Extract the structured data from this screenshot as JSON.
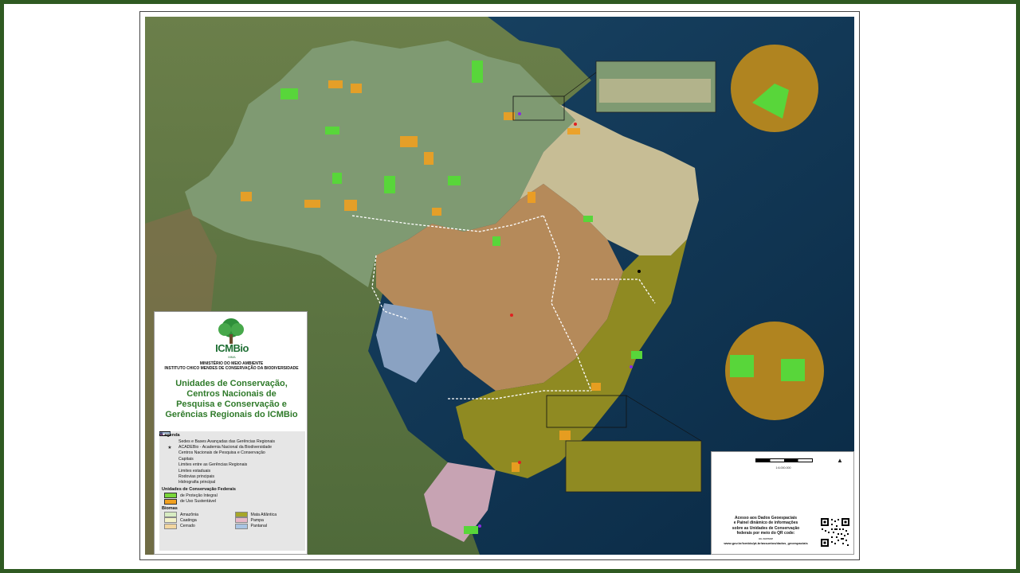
{
  "logo": {
    "name": "ICMBio",
    "subtitle": "MMA"
  },
  "ministry": {
    "line1": "MINISTÉRIO DO MEIO AMBIENTE",
    "line2": "INSTITUTO CHICO MENDES DE CONSERVAÇÃO DA BIODIVERSIDADE"
  },
  "title": {
    "line1": "Unidades de Conservação,",
    "line2": "Centros Nacionais de",
    "line3": "Pesquisa e Conservação e",
    "line4": "Gerências Regionais do ICMBio"
  },
  "legend": {
    "heading": "Legenda",
    "items": [
      {
        "label": "Sedes e Bases Avançadas das Gerências Regionais",
        "symbol": "red-dot"
      },
      {
        "label": "ACADEBio - Academia Nacional da Biodiversidade",
        "symbol": "star"
      },
      {
        "label": "Centros Nacionais de Pesquisa e Conservação",
        "symbol": "purple-dot"
      },
      {
        "label": "Capitais",
        "symbol": "black-dot"
      },
      {
        "label": "Limites entre as Gerências Regionais",
        "symbol": "white-line"
      },
      {
        "label": "Limites estaduais",
        "symbol": "black-box"
      },
      {
        "label": "Rodovias principais",
        "symbol": "red-line"
      },
      {
        "label": "Hidrografia principal",
        "symbol": "blue-line"
      }
    ],
    "uc_heading": "Unidades de Conservação Federais",
    "uc_items": [
      {
        "label": "de Proteção Integral",
        "color": "#7ad63a"
      },
      {
        "label": "de Uso Sustentável",
        "color": "#f0a020"
      }
    ],
    "biomas_heading": "Biomas",
    "biomas": [
      {
        "label": "Amazônia",
        "color": "#d7ecc2"
      },
      {
        "label": "Mata Atlântica",
        "color": "#a6a629"
      },
      {
        "label": "Caatinga",
        "color": "#f3f2c8"
      },
      {
        "label": "Pampa",
        "color": "#e8b7c8"
      },
      {
        "label": "Cerrado",
        "color": "#f2d6a0"
      },
      {
        "label": "Pantanal",
        "color": "#a9c4e3"
      }
    ]
  },
  "info": {
    "scale": "1:6.000.000",
    "access_line1": "Acesso aos Dados Geoespaciais",
    "access_line2": "e Painel dinâmico de informações",
    "access_line3": "sobre as Unidades de Conservação",
    "access_line4": "federais por meio do QR code:",
    "access_or": "ou acesse",
    "access_url": "www.gov.br/icmbio/pt-br/assuntos/dados_geoespaciais"
  },
  "colors": {
    "frame": "#2f5a22",
    "ocean": "#0d3655",
    "amazonia": "#7f9a72",
    "cerrado": "#b58a5a",
    "caatinga": "#c7bd95",
    "mata_atlantica": "#8f8a22",
    "pampa": "#c7a3b3",
    "pantanal": "#8aa2c2",
    "protecao_integral": "#58d63a",
    "uso_sustentavel": "#f0a020"
  }
}
